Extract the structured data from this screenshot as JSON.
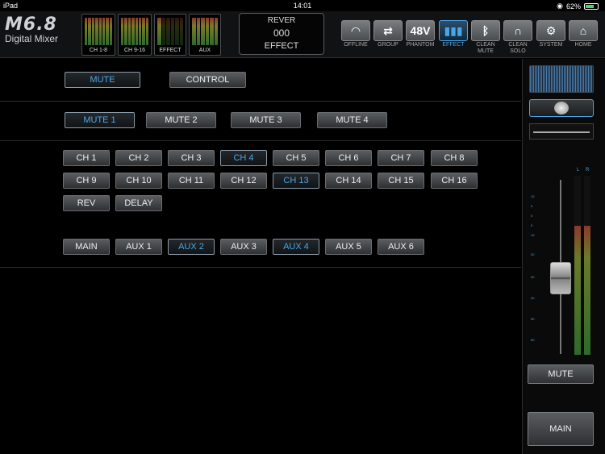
{
  "status": {
    "device": "iPad",
    "time": "14:01",
    "battery": "62%",
    "battery_level": 0.62
  },
  "header": {
    "logo_model": "M6.8",
    "logo_sub": "Digital Mixer",
    "meters": [
      {
        "label": "CH 1-8"
      },
      {
        "label": "CH 9-16"
      },
      {
        "label": "EFFECT"
      },
      {
        "label": "AUX"
      }
    ],
    "display": {
      "line1": "REVER",
      "line2": "000",
      "line3": "EFFECT"
    },
    "toolbar": [
      {
        "label": "OFFLINE",
        "icon": "wifi-icon",
        "glyph": ""
      },
      {
        "label": "GROUP",
        "icon": "arrows-icon",
        "glyph": ""
      },
      {
        "label": "PHANTOM",
        "icon": "48v-icon",
        "glyph": "48V"
      },
      {
        "label": "EFFECT",
        "icon": "bars-icon",
        "glyph": ""
      },
      {
        "label": "CLEAN MUTE",
        "icon": "bluetooth-icon",
        "glyph": ""
      },
      {
        "label": "CLEAN SOLO",
        "icon": "headphones-icon",
        "glyph": ""
      },
      {
        "label": "SYSTEM",
        "icon": "gear-icon",
        "glyph": ""
      },
      {
        "label": "HOME",
        "icon": "home-icon",
        "glyph": ""
      }
    ]
  },
  "tabs": {
    "mute": "MUTE",
    "control": "CONTROL"
  },
  "mute_groups": [
    "MUTE 1",
    "MUTE 2",
    "MUTE 3",
    "MUTE 4"
  ],
  "channels_row1": [
    "CH 1",
    "CH 2",
    "CH 3",
    "CH 4",
    "CH 5",
    "CH 6",
    "CH 7",
    "CH 8"
  ],
  "channels_row2": [
    "CH 9",
    "CH 10",
    "CH 11",
    "CH 12",
    "CH 13",
    "CH 14",
    "CH 15",
    "CH 16"
  ],
  "effects": [
    "REV",
    "DELAY"
  ],
  "outputs": [
    "MAIN",
    "AUX 1",
    "AUX 2",
    "AUX 3",
    "AUX 4",
    "AUX 5",
    "AUX 6"
  ],
  "right_panel": {
    "l": "L",
    "r": "R",
    "mute_label": "MUTE",
    "main_label": "MAIN"
  },
  "colors": {
    "accent": "#4aa6e8",
    "background": "#000000"
  }
}
